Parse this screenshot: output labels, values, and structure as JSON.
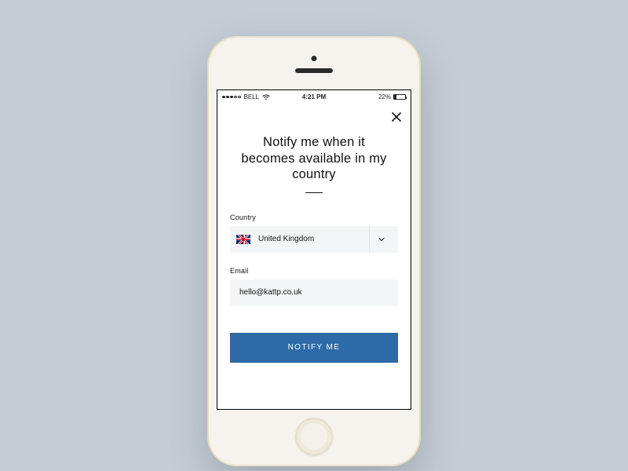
{
  "status": {
    "carrier": "BELL",
    "time": "4:21 PM",
    "battery_pct": "22%"
  },
  "modal": {
    "heading": "Notify me when it becomes available in my country"
  },
  "form": {
    "country_label": "Country",
    "country_value": "United Kingdom",
    "email_label": "Email",
    "email_value": "hello@kattp.co.uk"
  },
  "cta": {
    "label": "NOTIFY ME"
  }
}
